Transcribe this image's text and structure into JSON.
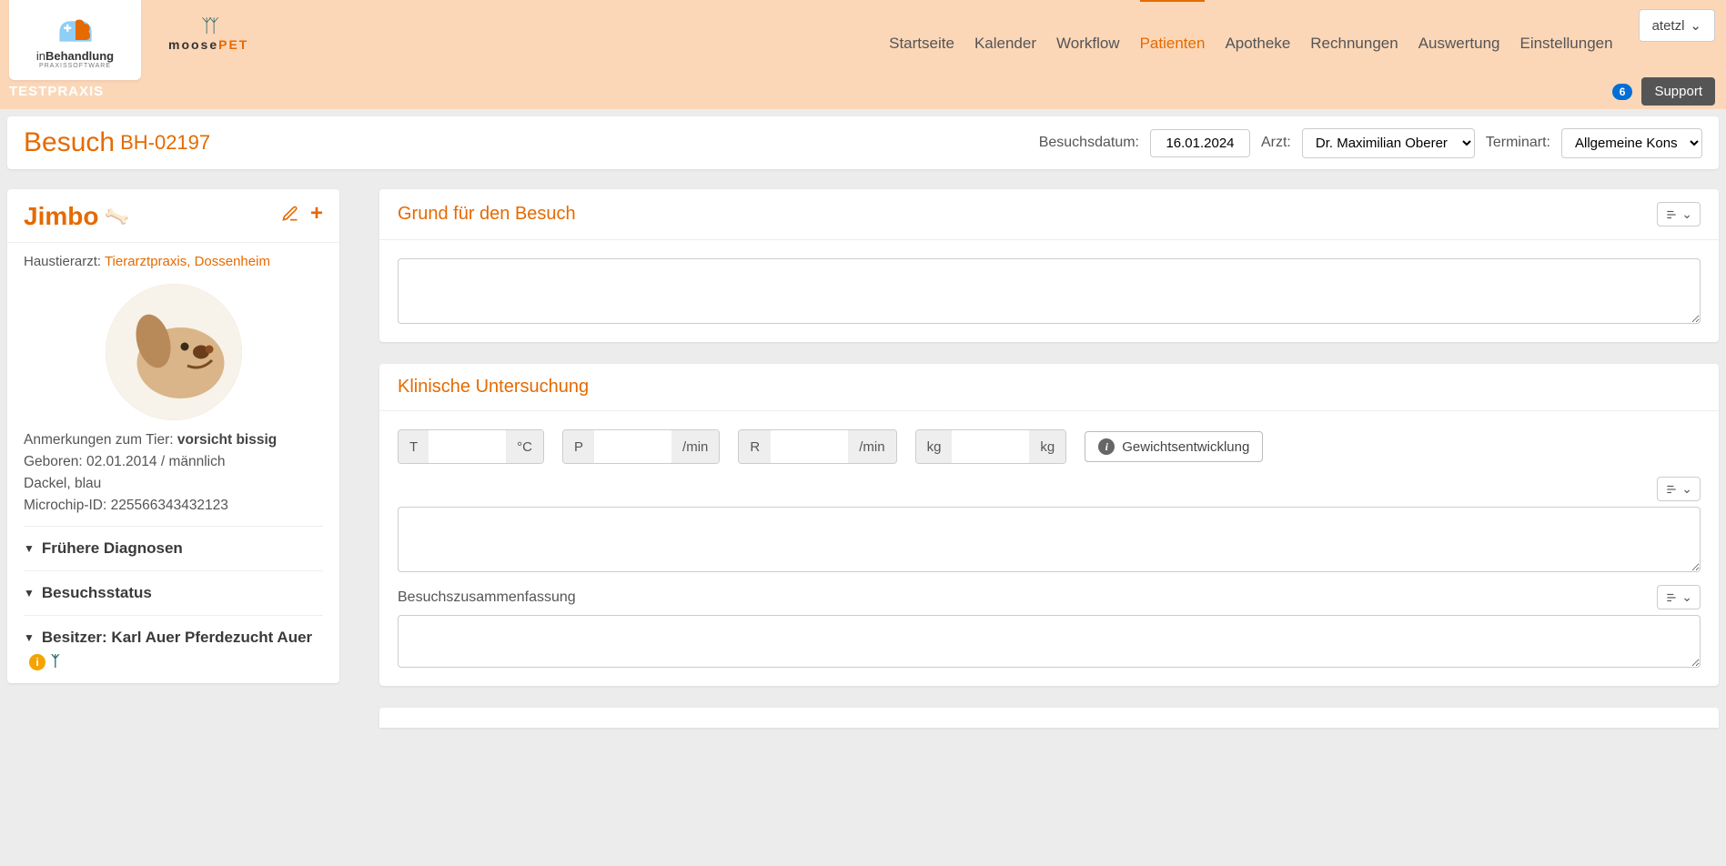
{
  "app": {
    "logo_main": "inBehandlung",
    "logo_sub": "PRAXISSOFTWARE",
    "practice_label": "TESTPRAXIS",
    "partner_logo": "moosePET"
  },
  "nav": {
    "items": [
      {
        "label": "Startseite",
        "active": false
      },
      {
        "label": "Kalender",
        "active": false
      },
      {
        "label": "Workflow",
        "active": false
      },
      {
        "label": "Patienten",
        "active": true
      },
      {
        "label": "Apotheke",
        "active": false
      },
      {
        "label": "Rechnungen",
        "active": false
      },
      {
        "label": "Auswertung",
        "active": false
      },
      {
        "label": "Einstellungen",
        "active": false
      }
    ]
  },
  "user": {
    "name": "atetzl",
    "notification_count": "6",
    "support_label": "Support"
  },
  "page": {
    "title": "Besuch",
    "visit_id": "BH-02197",
    "date_label": "Besuchsdatum:",
    "date_value": "16.01.2024",
    "doctor_label": "Arzt:",
    "doctor_value": "Dr. Maximilian Oberer",
    "appt_type_label": "Terminart:",
    "appt_type_value": "Allgemeine Kons"
  },
  "patient": {
    "name": "Jimbo",
    "vet_label": "Haustierarzt:",
    "vet_practice": "Tierarztpraxis, Dossenheim",
    "notes_label": "Anmerkungen zum Tier:",
    "notes_value": "vorsicht bissig",
    "born_label": "Geboren:",
    "born_value": "02.01.2014 / männlich",
    "breed_line": "Dackel, blau",
    "chip_label": "Microchip-ID:",
    "chip_value": "225566343432123",
    "accordion": {
      "diagnoses": "Frühere Diagnosen",
      "visit_status": "Besuchsstatus",
      "owner": "Besitzer: Karl Auer Pferdezucht Auer"
    }
  },
  "visit_reason": {
    "title": "Grund für den Besuch",
    "text": ""
  },
  "clinical": {
    "title": "Klinische Untersuchung",
    "t_label": "T",
    "t_unit": "°C",
    "p_label": "P",
    "p_unit": "/min",
    "r_label": "R",
    "r_unit": "/min",
    "kg_label": "kg",
    "kg_unit": "kg",
    "weight_btn": "Gewichtsentwicklung",
    "exam_text": "",
    "summary_label": "Besuchszusammenfassung",
    "summary_text": ""
  }
}
